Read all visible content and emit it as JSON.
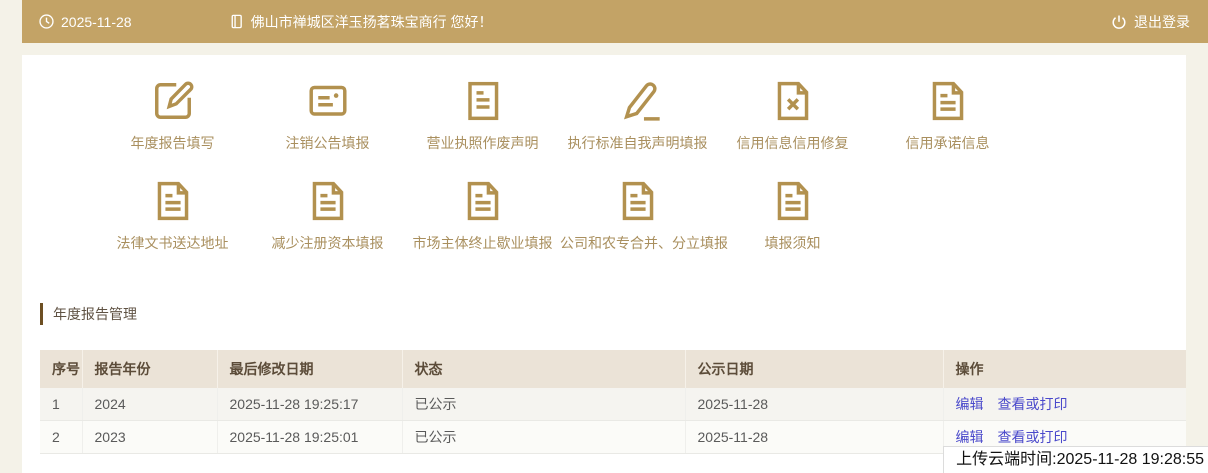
{
  "topbar": {
    "clock_icon": "clock-icon",
    "date": "2025-11-28",
    "company_icon": "certificate-icon",
    "company_greeting": "佛山市禅城区洋玉扬茗珠宝商行 您好！",
    "logout_icon": "power-icon",
    "logout_label": "退出登录"
  },
  "shortcuts": {
    "rows": [
      [
        {
          "label": "年度报告填写",
          "icon": "edit-square-icon"
        },
        {
          "label": "注销公告填报",
          "icon": "card-lines-icon"
        },
        {
          "label": "营业执照作废声明",
          "icon": "doc-lines-icon"
        },
        {
          "label": "执行标准自我声明填报",
          "icon": "pencil-underline-icon"
        },
        {
          "label": "信用信息信用修复",
          "icon": "doc-x-icon"
        },
        {
          "label": "信用承诺信息",
          "icon": "doc-fold-lines-icon"
        }
      ],
      [
        {
          "label": "法律文书送达地址",
          "icon": "doc-fold-lines-icon"
        },
        {
          "label": "减少注册资本填报",
          "icon": "doc-fold-lines-icon"
        },
        {
          "label": "市场主体终止歇业填报",
          "icon": "doc-fold-lines-icon"
        },
        {
          "label": "公司和农专合并、分立填报",
          "icon": "doc-fold-lines-icon"
        },
        {
          "label": "填报须知",
          "icon": "doc-fold-lines-icon"
        }
      ]
    ]
  },
  "annual_report_section": {
    "title": "年度报告管理",
    "table": {
      "headers": [
        "序号",
        "报告年份",
        "最后修改日期",
        "状态",
        "公示日期",
        "操作"
      ],
      "rows": [
        {
          "seq": "1",
          "year": "2024",
          "last_modified": "2025-11-28 19:25:17",
          "status": "已公示",
          "publish_date": "2025-11-28",
          "actions": [
            "编辑",
            "查看或打印"
          ]
        },
        {
          "seq": "2",
          "year": "2023",
          "last_modified": "2025-11-28 19:25:01",
          "status": "已公示",
          "publish_date": "2025-11-28",
          "actions": [
            "编辑",
            "查看或打印"
          ]
        }
      ]
    }
  },
  "overlay": {
    "upload_time_text": "上传云端时间:2025-11-28 19:28:55"
  },
  "colors": {
    "topbar_bg": "#c3a366",
    "page_bg": "#f4f2e8",
    "icon_gold": "#b2914f",
    "icon_label": "#a98f5e",
    "table_header_bg": "#ebe3d7",
    "table_header_text": "#5c4c39",
    "link_blue": "#4a49cb"
  }
}
